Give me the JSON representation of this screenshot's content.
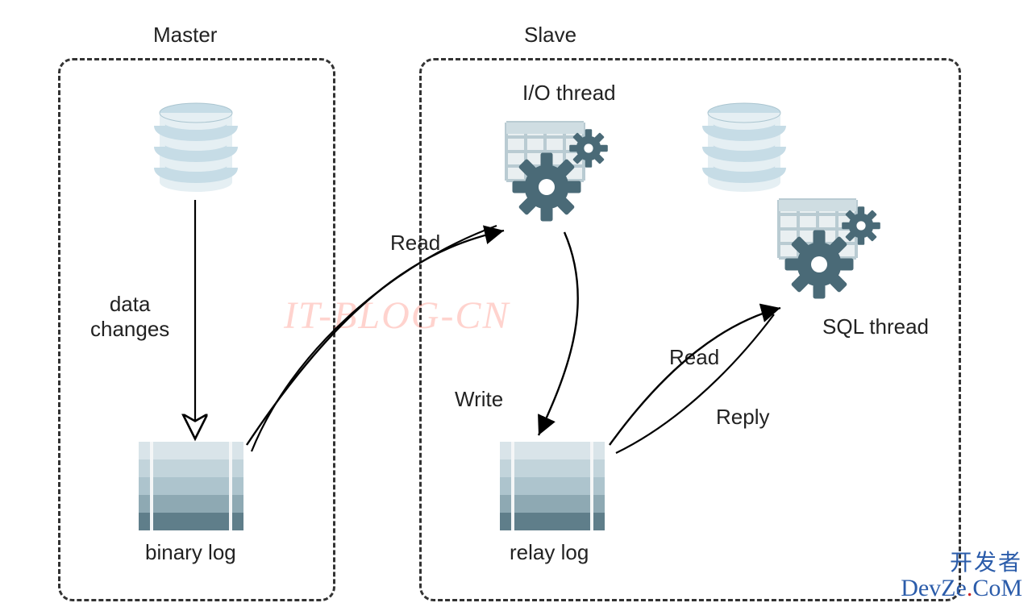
{
  "diagram": {
    "master_title": "Master",
    "slave_title": "Slave",
    "io_thread_label": "I/O thread",
    "sql_thread_label": "SQL thread",
    "data_label_line1": "data",
    "data_label_line2": "changes",
    "binary_log_label": "binary log",
    "relay_log_label": "relay log",
    "edge_read1": "Read",
    "edge_write": "Write",
    "edge_read2": "Read",
    "edge_reply": "Reply",
    "watermark": "IT-BLOG-CN",
    "colors": {
      "db_light": "#c6dce6",
      "db_mid": "#9dbfcf",
      "stack_border": "#e9ecee",
      "stack_rows": [
        "#d9e4e9",
        "#c2d4db",
        "#adc4cd",
        "#8ea9b3",
        "#5f7e8a"
      ],
      "gear_dark": "#4a6a77",
      "arrow": "#000000",
      "dashed": "#333333"
    },
    "logo": {
      "cn": "开发者",
      "en_pre": "DevZe",
      "en_dot": ".",
      "en_post": "CoM"
    }
  }
}
